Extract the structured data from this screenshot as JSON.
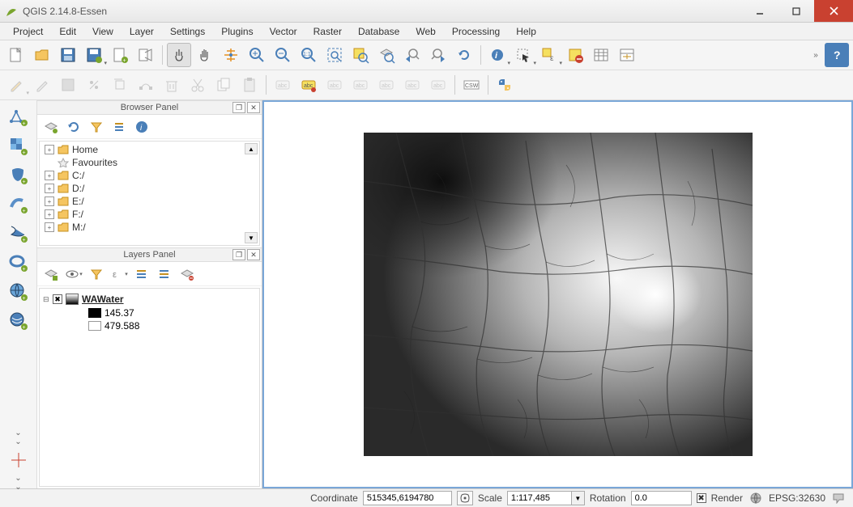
{
  "window": {
    "title": "QGIS 2.14.8-Essen"
  },
  "menu": [
    "Project",
    "Edit",
    "View",
    "Layer",
    "Settings",
    "Plugins",
    "Vector",
    "Raster",
    "Database",
    "Web",
    "Processing",
    "Help"
  ],
  "browser_panel": {
    "title": "Browser Panel",
    "items": [
      {
        "label": "Home",
        "icon": "folder"
      },
      {
        "label": "Favourites",
        "icon": "star"
      },
      {
        "label": "C:/",
        "icon": "folder"
      },
      {
        "label": "D:/",
        "icon": "folder"
      },
      {
        "label": "E:/",
        "icon": "folder"
      },
      {
        "label": "F:/",
        "icon": "folder"
      },
      {
        "label": "M:/",
        "icon": "folder"
      }
    ]
  },
  "layers_panel": {
    "title": "Layers Panel",
    "layer": {
      "name": "WAWater",
      "min": "145.37",
      "max": "479.588"
    }
  },
  "status": {
    "coordinate_label": "Coordinate",
    "coordinate_value": "515345,6194780",
    "scale_label": "Scale",
    "scale_value": "1:117,485",
    "rotation_label": "Rotation",
    "rotation_value": "0.0",
    "render_label": "Render",
    "epsg": "EPSG:32630"
  }
}
